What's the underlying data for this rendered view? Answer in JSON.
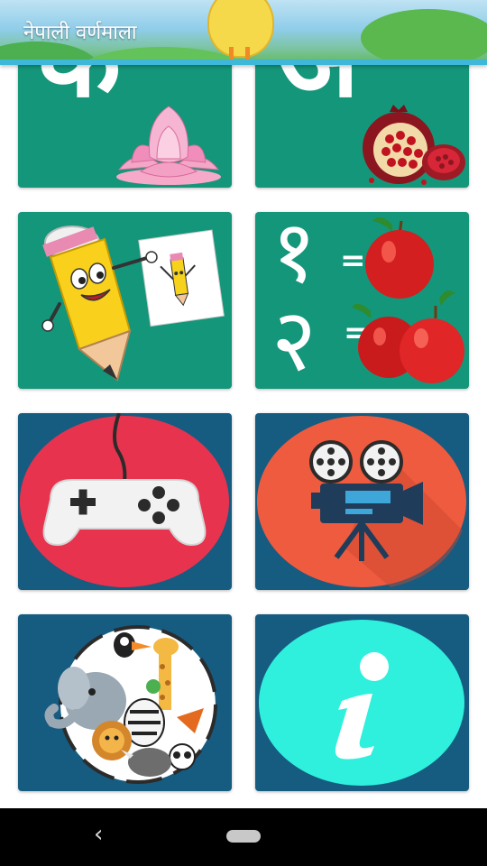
{
  "app": {
    "title": "नेपाली वर्णमाला"
  },
  "tiles": [
    {
      "name": "alphabet-consonants",
      "letter": "क",
      "icon": "lotus-icon",
      "color": "#14967a"
    },
    {
      "name": "alphabet-vowels",
      "letter": "अ",
      "icon": "pomegranate-icon",
      "color": "#14967a"
    },
    {
      "name": "drawing",
      "icon": "pencil-drawing-icon",
      "color": "#14967a"
    },
    {
      "name": "numbers",
      "numerals": [
        "१",
        "२"
      ],
      "equals": "=",
      "icon": "apple-counting-icon",
      "color": "#14967a"
    },
    {
      "name": "games",
      "icon": "gamepad-icon",
      "color": "#165b80"
    },
    {
      "name": "videos",
      "icon": "movie-camera-icon",
      "color": "#165b80"
    },
    {
      "name": "animals",
      "icon": "animals-icon",
      "color": "#165b80"
    },
    {
      "name": "info",
      "icon": "info-icon",
      "color": "#165b80"
    }
  ],
  "navigation": {
    "back_icon": "‹",
    "home_icon": "home-pill-icon"
  }
}
